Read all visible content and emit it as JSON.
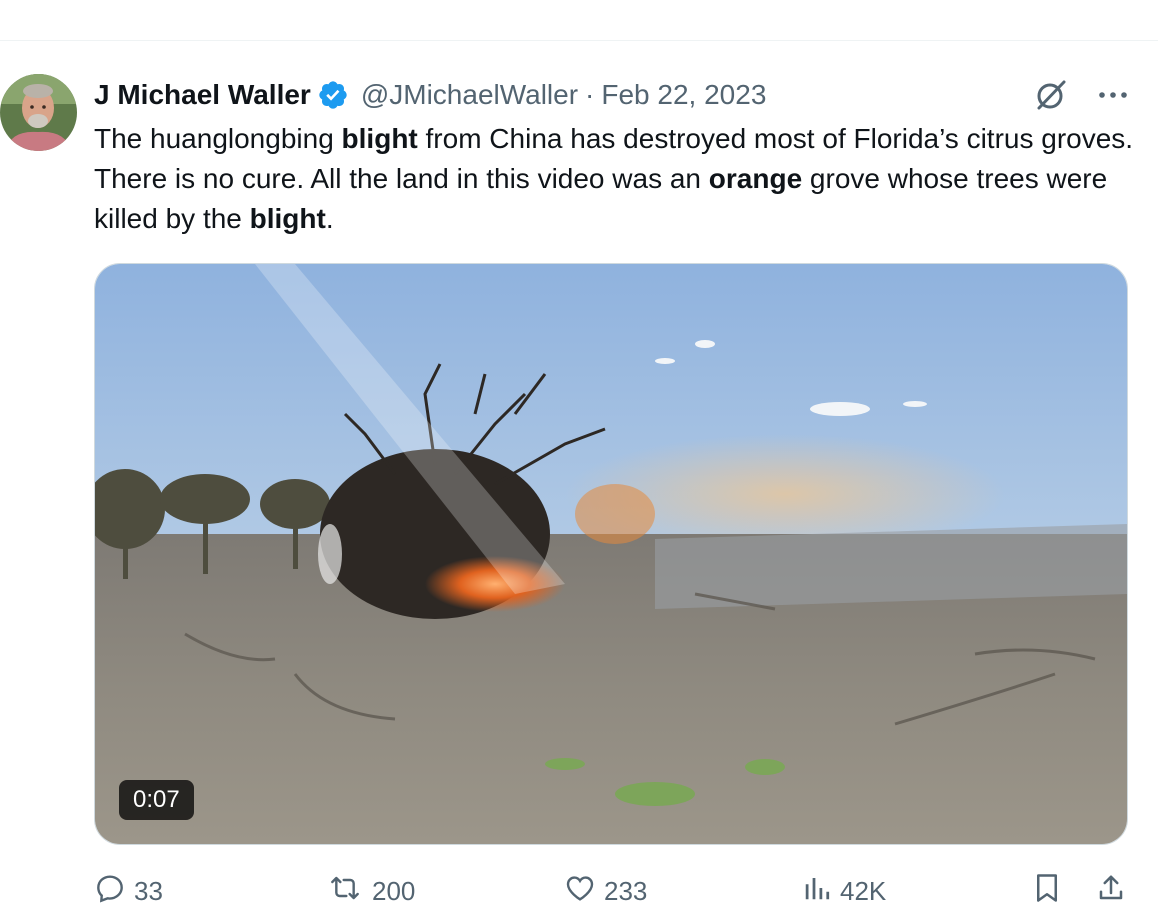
{
  "author": {
    "display_name": "J Michael Waller",
    "handle": "@JMichaelWaller",
    "separator": "·",
    "date": "Feb 22, 2023"
  },
  "tweet": {
    "segments": [
      {
        "text": "The huanglongbing ",
        "bold": false
      },
      {
        "text": "blight",
        "bold": true
      },
      {
        "text": " from China has destroyed most of Florida’s citrus groves. There is no cure. All the land in this video was an ",
        "bold": false
      },
      {
        "text": "orange",
        "bold": true
      },
      {
        "text": " grove whose trees were killed by the ",
        "bold": false
      },
      {
        "text": "blight",
        "bold": true
      },
      {
        "text": ".",
        "bold": false
      }
    ]
  },
  "media": {
    "timestamp": "0:07"
  },
  "actions": {
    "replies": "33",
    "retweets": "200",
    "likes": "233",
    "views": "42K"
  },
  "icons": {
    "verified": "verified-badge-icon",
    "grok": "grok-icon",
    "more": "more-icon",
    "reply": "reply-icon",
    "retweet": "retweet-icon",
    "like": "like-icon",
    "views": "views-icon",
    "bookmark": "bookmark-icon",
    "share": "share-icon"
  },
  "colors": {
    "text": "#0f1419",
    "secondary": "#536471",
    "verified_blue": "#1d9bf0",
    "border": "#cfd9de"
  }
}
